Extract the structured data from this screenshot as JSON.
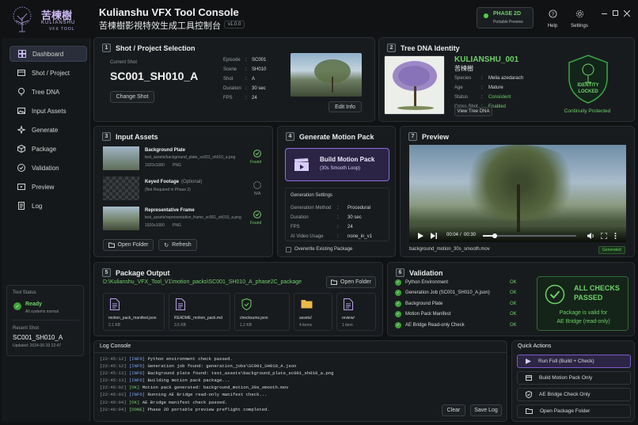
{
  "app": {
    "title": "Kulianshu VFX Tool Console",
    "subtitle": "苦楝樹影視特效生成工具控制台",
    "version": "v1.0.0",
    "logo_cn": "苦楝樹",
    "logo_en1": "KULIANSHU",
    "logo_en2": "VFX TOOL"
  },
  "phase": {
    "label": "PHASE 2D",
    "sub": "Portable Preview"
  },
  "top_actions": {
    "help": "Help",
    "settings": "Settings"
  },
  "sidebar": {
    "items": [
      {
        "label": "Dashboard"
      },
      {
        "label": "Shot / Project"
      },
      {
        "label": "Tree DNA"
      },
      {
        "label": "Input Assets"
      },
      {
        "label": "Generate"
      },
      {
        "label": "Package"
      },
      {
        "label": "Validation"
      },
      {
        "label": "Preview"
      },
      {
        "label": "Log"
      }
    ],
    "status_title": "Tool Status",
    "status_ready": "Ready",
    "status_sub": "All systems normal",
    "recent_title": "Recent Shot",
    "recent_shot": "SC001_SH010_A",
    "recent_updated": "Updated: 2024-05-20 22:47"
  },
  "shot": {
    "num": "1",
    "title": "Shot / Project Selection",
    "current_label": "Current Shot",
    "current": "SC001_SH010_A",
    "change_btn": "Change Shot",
    "edit_btn": "Edit Info",
    "fields": [
      {
        "k": "Episode",
        "v": "SC001"
      },
      {
        "k": "Scene",
        "v": "SH010"
      },
      {
        "k": "Shot",
        "v": "A"
      },
      {
        "k": "Duration",
        "v": "30 sec"
      },
      {
        "k": "FPS",
        "v": "24"
      }
    ]
  },
  "dna": {
    "num": "2",
    "title": "Tree DNA Identity",
    "name": "KULIANSHU_001",
    "name_cn": "苦楝樹",
    "view_btn": "View Tree DNA",
    "fields": [
      {
        "k": "Species",
        "v": "Melia azedarach"
      },
      {
        "k": "Age",
        "v": "Mature"
      },
      {
        "k": "Status",
        "v": "Consistent"
      },
      {
        "k": "Cross Shot",
        "v": "Enabled"
      }
    ],
    "badge1": "IDENTITY",
    "badge2": "LOCKED",
    "protect": "Continuity Protected"
  },
  "assets": {
    "num": "3",
    "title": "Input Assets",
    "items": [
      {
        "name": "Background Plate",
        "opt": "",
        "file": "test_assets/background_plate_sc001_sh010_a.png",
        "meta1": "1920x1080",
        "meta2": "PNG",
        "status": "Found"
      },
      {
        "name": "Keyed Footage",
        "opt": "(Optional)",
        "file": "(Not Required in Phase 2)",
        "meta1": "",
        "meta2": "",
        "status": "N/A"
      },
      {
        "name": "Representative Frame",
        "opt": "",
        "file": "test_assets/representative_frame_sc001_sh010_a.png",
        "meta1": "1920x1080",
        "meta2": "PNG",
        "status": "Found"
      }
    ],
    "open_btn": "Open Folder",
    "refresh_btn": "Refresh"
  },
  "generate": {
    "num": "4",
    "title": "Generate Motion Pack",
    "build": "Build Motion Pack",
    "build_sub": "(30s Smooth Loop)",
    "settings_title": "Generation Settings",
    "fields": [
      {
        "k": "Generation Method",
        "v": "Procedural"
      },
      {
        "k": "Duration",
        "v": "30 sec"
      },
      {
        "k": "FPS",
        "v": "24"
      },
      {
        "k": "AI Video Usage",
        "v": "none_in_v1"
      }
    ],
    "overwrite": "Overwrite Existing Package"
  },
  "preview": {
    "num": "7",
    "title": "Preview",
    "time": "00:04",
    "total": "00:30",
    "progress": 0.13,
    "file": "background_motion_30s_smooth.mov",
    "badge": "Generated"
  },
  "package": {
    "num": "5",
    "title": "Package Output",
    "path": "D:\\Kulianshu_VFX_Tool_V1\\motion_packs\\SC001_SH010_A_phase2C_package",
    "open_btn": "Open Folder",
    "files": [
      {
        "name": "motion_pack_manifest.json",
        "size": "2.1 KB"
      },
      {
        "name": "README_motion_pack.md",
        "size": "3.5 KB"
      },
      {
        "name": "checksums.json",
        "size": "1.2 KB"
      },
      {
        "name": "assets/",
        "size": "4 items"
      },
      {
        "name": "review/",
        "size": "1 item"
      }
    ]
  },
  "validation": {
    "num": "6",
    "title": "Validation",
    "items": [
      {
        "label": "Python Environment",
        "status": "OK"
      },
      {
        "label": "Generation Job (SC001_SH010_A.json)",
        "status": "OK"
      },
      {
        "label": "Background Plate",
        "status": "OK"
      },
      {
        "label": "Motion Pack Manifest",
        "status": "OK"
      },
      {
        "label": "AE Bridge Read-only Check",
        "status": "OK"
      }
    ],
    "all1": "ALL CHECKS",
    "all2": "PASSED",
    "valid1": "Package is valid for",
    "valid2": "AE Bridge (read-only)"
  },
  "log": {
    "title": "Log Console",
    "clear": "Clear",
    "save": "Save Log",
    "lines": [
      {
        "t": "[22:45:12]",
        "lv": "[INFO]",
        "msg": "Python environment check passed."
      },
      {
        "t": "[22:45:12]",
        "lv": "[INFO]",
        "msg": "Generation job found: generation_jobs\\SC001_SH010_A.json"
      },
      {
        "t": "[22:45:13]",
        "lv": "[INFO]",
        "msg": "Background plate found: test_assets\\background_plate_sc001_sh010_a.png"
      },
      {
        "t": "[22:45:13]",
        "lv": "[INFO]",
        "msg": "Building motion pack package..."
      },
      {
        "t": "[22:46:02]",
        "lv": "[OK]",
        "msg": "Motion pack generated: background_motion_30s_smooth.mov"
      },
      {
        "t": "[22:46:03]",
        "lv": "[INFO]",
        "msg": "Running AE Bridge read-only manifest check..."
      },
      {
        "t": "[22:46:04]",
        "lv": "[OK]",
        "msg": "AE Bridge manifest check passed."
      },
      {
        "t": "[22:46:04]",
        "lv": "[DONE]",
        "msg": "Phase 2D portable preview preflight completed."
      }
    ]
  },
  "quick": {
    "title": "Quick Actions",
    "items": [
      {
        "label": "Run Full (Build + Check)"
      },
      {
        "label": "Build Motion Pack Only"
      },
      {
        "label": "AE Bridge Check Only"
      },
      {
        "label": "Open Package Folder"
      }
    ]
  },
  "colors": {
    "accent": "#6fd06a",
    "purple": "#7b5cc7",
    "bg": "#101214"
  }
}
